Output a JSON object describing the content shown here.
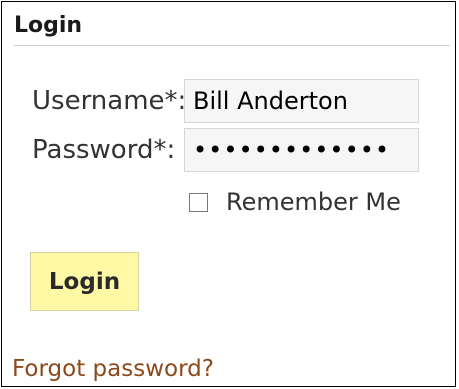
{
  "panel": {
    "title": "Login"
  },
  "form": {
    "username_label": "Username*:",
    "username_value": "Bill Anderton",
    "password_label": "Password*:",
    "password_value": "•••••••••••••",
    "remember_label": "Remember Me",
    "remember_checked": false,
    "submit_label": "Login"
  },
  "links": {
    "forgot_password": "Forgot password?"
  },
  "colors": {
    "button_background": "#fff9a6",
    "link": "#8b4a1c",
    "input_background": "#f6f6f6"
  }
}
